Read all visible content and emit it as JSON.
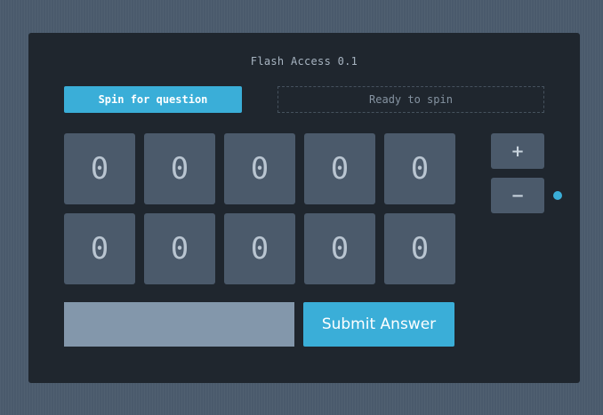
{
  "app": {
    "title": "Flash Access 0.1"
  },
  "controls": {
    "spin_label": "Spin for question",
    "status_text": "Ready to spin",
    "plus_label": "+",
    "minus_label": "−",
    "submit_label": "Submit Answer"
  },
  "answer": {
    "value": "",
    "placeholder": ""
  },
  "grid": {
    "rows": [
      [
        "0",
        "0",
        "0",
        "0",
        "0"
      ],
      [
        "0",
        "0",
        "0",
        "0",
        "0"
      ]
    ]
  },
  "colors": {
    "accent": "#3aaed8",
    "panel": "#1f262e",
    "cell": "#4b5a6b",
    "background": "#4a5a6c"
  },
  "indicator": {
    "icon": "status-dot-icon",
    "color": "#3aaed8"
  }
}
